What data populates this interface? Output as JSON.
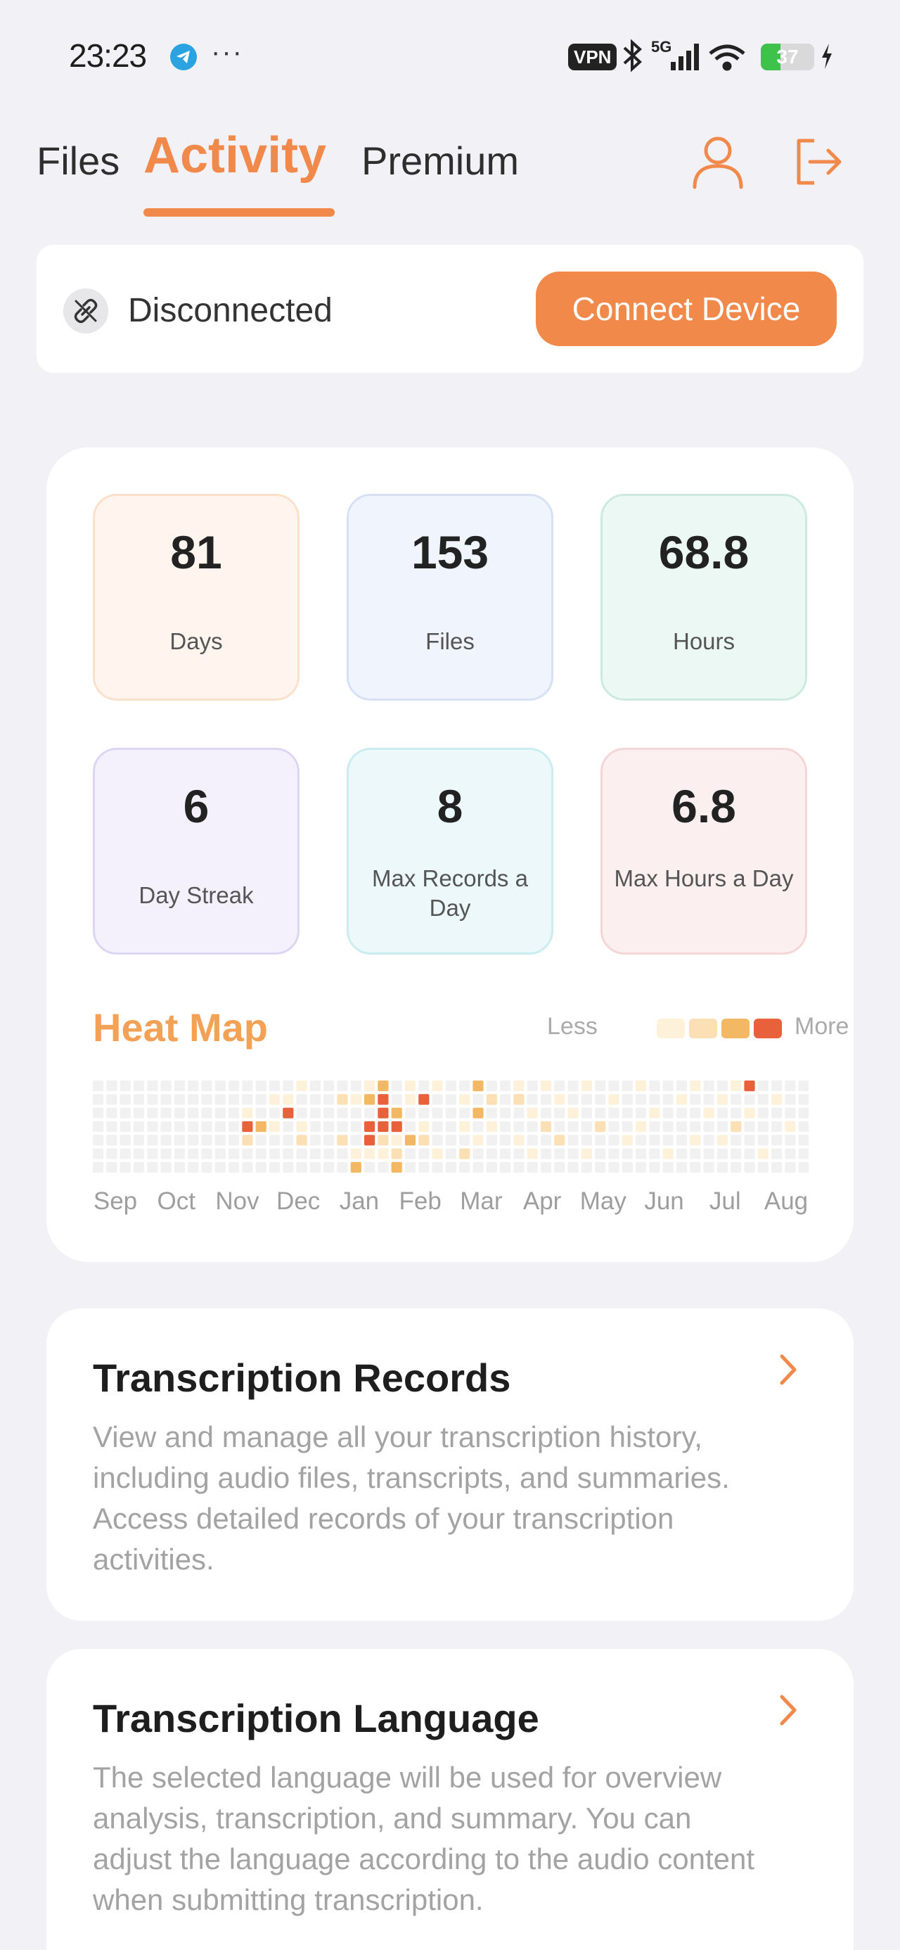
{
  "status_bar": {
    "time": "23:23",
    "dots": "···",
    "vpn": "VPN",
    "network": "5G",
    "battery": "37",
    "battery_level": 0.37
  },
  "header": {
    "tabs": [
      {
        "label": "Files",
        "active": false
      },
      {
        "label": "Activity",
        "active": true
      },
      {
        "label": "Premium",
        "active": false
      }
    ],
    "accent_color": "#f0894a"
  },
  "connection": {
    "status": "Disconnected",
    "button_label": "Connect Device"
  },
  "stats": [
    {
      "value": "81",
      "label": "Days",
      "bg": "#fff5ee",
      "border": "#fbe0cc"
    },
    {
      "value": "153",
      "label": "Files",
      "bg": "#eff4fd",
      "border": "#d6e1f6"
    },
    {
      "value": "68.8",
      "label": "Hours",
      "bg": "#ecf8f4",
      "border": "#cdeade"
    },
    {
      "value": "6",
      "label": "Day Streak",
      "bg": "#f4f1fd",
      "border": "#ddd6f3"
    },
    {
      "value": "8",
      "label": "Max Records a Day",
      "bg": "#ecf8fa",
      "border": "#cbecf1"
    },
    {
      "value": "6.8",
      "label": "Max Hours a Day",
      "bg": "#fcefef",
      "border": "#f5d6d6"
    }
  ],
  "heatmap": {
    "title": "Heat Map",
    "legend_less": "Less",
    "legend_more": "More",
    "level_colors": [
      "#f1f1f1",
      "#fdf1da",
      "#fbe0b5",
      "#f3b864",
      "#e8613a"
    ],
    "months": [
      "Sep",
      "Oct",
      "Nov",
      "Dec",
      "Jan",
      "Feb",
      "Mar",
      "Apr",
      "May",
      "Jun",
      "Jul",
      "Aug"
    ],
    "weeks": 53,
    "active_cells": [
      [
        11,
        2,
        1
      ],
      [
        11,
        3,
        4
      ],
      [
        11,
        4,
        2
      ],
      [
        12,
        3,
        3
      ],
      [
        13,
        1,
        1
      ],
      [
        13,
        3,
        1
      ],
      [
        14,
        2,
        4
      ],
      [
        14,
        1,
        1
      ],
      [
        15,
        0,
        1
      ],
      [
        15,
        3,
        1
      ],
      [
        15,
        4,
        2
      ],
      [
        18,
        1,
        2
      ],
      [
        18,
        4,
        2
      ],
      [
        19,
        1,
        1
      ],
      [
        19,
        5,
        1
      ],
      [
        19,
        6,
        3
      ],
      [
        20,
        0,
        1
      ],
      [
        20,
        1,
        3
      ],
      [
        20,
        3,
        4
      ],
      [
        20,
        4,
        4
      ],
      [
        20,
        5,
        1
      ],
      [
        21,
        0,
        3
      ],
      [
        21,
        1,
        4
      ],
      [
        21,
        2,
        4
      ],
      [
        21,
        3,
        4
      ],
      [
        21,
        4,
        2
      ],
      [
        21,
        5,
        1
      ],
      [
        22,
        2,
        3
      ],
      [
        22,
        3,
        4
      ],
      [
        22,
        4,
        1
      ],
      [
        22,
        5,
        2
      ],
      [
        22,
        6,
        3
      ],
      [
        23,
        0,
        1
      ],
      [
        23,
        1,
        1
      ],
      [
        23,
        4,
        3
      ],
      [
        24,
        1,
        4
      ],
      [
        24,
        3,
        1
      ],
      [
        24,
        4,
        2
      ],
      [
        25,
        0,
        1
      ],
      [
        25,
        5,
        1
      ],
      [
        27,
        1,
        1
      ],
      [
        27,
        3,
        1
      ],
      [
        27,
        5,
        2
      ],
      [
        28,
        0,
        3
      ],
      [
        28,
        2,
        3
      ],
      [
        28,
        4,
        1
      ],
      [
        29,
        1,
        2
      ],
      [
        29,
        3,
        1
      ],
      [
        31,
        0,
        1
      ],
      [
        31,
        1,
        2
      ],
      [
        31,
        4,
        1
      ],
      [
        32,
        2,
        1
      ],
      [
        32,
        5,
        1
      ],
      [
        33,
        0,
        1
      ],
      [
        33,
        3,
        2
      ],
      [
        34,
        1,
        1
      ],
      [
        34,
        4,
        2
      ],
      [
        35,
        2,
        1
      ],
      [
        36,
        0,
        1
      ],
      [
        36,
        5,
        1
      ],
      [
        37,
        3,
        2
      ],
      [
        38,
        1,
        1
      ],
      [
        39,
        4,
        1
      ],
      [
        40,
        0,
        1
      ],
      [
        40,
        3,
        1
      ],
      [
        41,
        2,
        1
      ],
      [
        42,
        5,
        1
      ],
      [
        43,
        1,
        1
      ],
      [
        44,
        0,
        1
      ],
      [
        44,
        4,
        1
      ],
      [
        45,
        2,
        1
      ],
      [
        46,
        1,
        1
      ],
      [
        46,
        4,
        1
      ],
      [
        47,
        0,
        1
      ],
      [
        47,
        3,
        2
      ],
      [
        48,
        0,
        4
      ],
      [
        48,
        2,
        1
      ],
      [
        49,
        5,
        1
      ],
      [
        50,
        1,
        1
      ],
      [
        51,
        3,
        1
      ]
    ]
  },
  "cards": [
    {
      "title": "Transcription Records",
      "description": "View and manage all your transcription history, including audio files, transcripts, and summaries. Access detailed records of your transcription activities."
    },
    {
      "title": "Transcription Language",
      "description": "The selected language will be used for overview analysis, transcription, and summary. You can adjust the language according to the audio content when submitting transcription."
    }
  ]
}
